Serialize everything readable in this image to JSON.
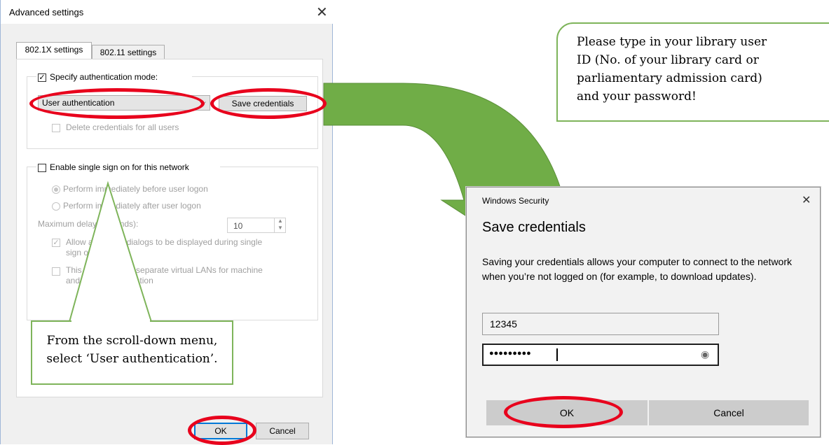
{
  "advanced_dialog": {
    "title": "Advanced settings",
    "tabs": [
      {
        "label": "802.1X settings",
        "active": true
      },
      {
        "label": "802.11 settings",
        "active": false
      }
    ],
    "specify_auth_mode": {
      "label": "Specify authentication mode:",
      "checked": true
    },
    "auth_mode_select": {
      "value": "User authentication"
    },
    "save_credentials_button": "Save credentials",
    "delete_credentials": {
      "label": "Delete credentials for all users",
      "checked": false
    },
    "sso": {
      "label": "Enable single sign on for this network",
      "checked": false,
      "perform_before": "Perform immediately before user logon",
      "perform_after": "Perform immediately after user logon",
      "max_delay_label": "Maximum delay (seconds):",
      "max_delay_value": "10",
      "allow_dialogs_line1": "Allow additional dialogs to be displayed during single",
      "allow_dialogs_line2": "sign on",
      "vlan_line1": "This network uses separate virtual LANs for machine",
      "vlan_line2": "and user authentication"
    },
    "ok_label": "OK",
    "cancel_label": "Cancel"
  },
  "security_dialog": {
    "caption": "Windows Security",
    "heading": "Save credentials",
    "description": "Saving your credentials allows your computer to connect to the network when you’re not logged on (for example, to download updates).",
    "username_value": "12345",
    "password_value": "●●●●●●●●●",
    "ok_label": "OK",
    "cancel_label": "Cancel"
  },
  "callouts": {
    "bottom_line1": "From the scroll-down menu,",
    "bottom_line2": "select ‘User authentication’.",
    "top_line1": "Please type in your library user",
    "top_line2": "ID (No. of your library card or",
    "top_line3": "parliamentary admission card)",
    "top_line4": "and your password!"
  },
  "colors": {
    "highlight_ring": "#e8001c",
    "callout_border": "#7eb45a",
    "arrow": "#70ad47",
    "focus_blue": "#0078d7"
  },
  "icons": [
    "close-icon",
    "chevron-down-icon",
    "spin-up-icon",
    "spin-down-icon",
    "reveal-password-icon",
    "curved-arrow"
  ]
}
